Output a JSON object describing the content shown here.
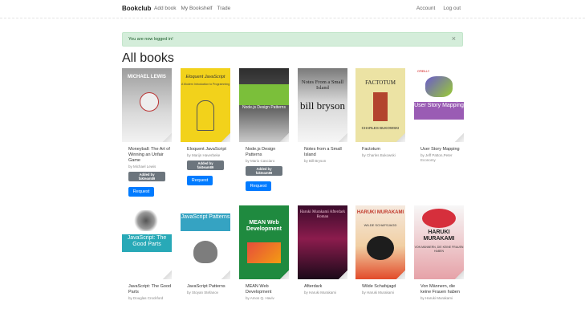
{
  "navbar": {
    "brand": "Bookclub",
    "left_links": [
      "Add book",
      "My Bookshelf",
      "Trade"
    ],
    "right_links": [
      "Account",
      "Log out"
    ]
  },
  "alert": {
    "message": "You are now logged in!",
    "close": "×"
  },
  "page": {
    "title": "All books"
  },
  "request_label": "Request",
  "added_label_line1": "Added by",
  "added_label_line2": "fakteam89",
  "books": [
    {
      "title": "Moneyball: The Art of Winning an Unfair Game",
      "author": "by Michael Lewis",
      "cover_top": "MICHAEL LEWIS",
      "cover_sub": "MONEYBALL"
    },
    {
      "title": "Eloquent JavaScript",
      "author": "by Marijn Haverbeke",
      "cover_top": "Eloquent JavaScript",
      "cover_sub": "A Modern Introduction to Programming"
    },
    {
      "title": "Node.js Design Patterns",
      "author": "by Mario Casciaro",
      "cover_top": "Node.js Design Patterns",
      "cover_sub": ""
    },
    {
      "title": "Notes from a Small Island",
      "author": "by Bill Bryson",
      "cover_top": "Notes From a Small Island",
      "cover_sub": "bill bryson"
    },
    {
      "title": "Factotum",
      "author": "by Charles Bukowski",
      "cover_top": "FACTOTUM",
      "cover_sub": "CHARLES BUKOWSKI"
    },
    {
      "title": "User Story Mapping",
      "author": "by Jeff Patton,Peter Economy",
      "cover_top": "O'REILLY",
      "cover_sub": "User Story Mapping"
    },
    {
      "title": "JavaScript: The Good Parts",
      "author": "by Douglas Crockford",
      "cover_top": "",
      "cover_sub": "JavaScript: The Good Parts"
    },
    {
      "title": "JavaScript Patterns",
      "author": "by Stoyan Stefanov",
      "cover_top": "",
      "cover_sub": "JavaScript Patterns"
    },
    {
      "title": "MEAN Web Development",
      "author": "by Amos Q. Haviv",
      "cover_top": "MEAN Web Development",
      "cover_sub": ""
    },
    {
      "title": "Afterdark",
      "author": "by Haruki Murakami",
      "cover_top": "Haruki Murakami Afterdark Roman",
      "cover_sub": ""
    },
    {
      "title": "Wilde Schafsjagd",
      "author": "by Haruki Murakami",
      "cover_top": "HARUKI MURAKAMI",
      "cover_sub": "WILDE SCHAFSJAGD"
    },
    {
      "title": "Von Männern, die keine Frauen haben",
      "author": "by Haruki Murakami",
      "cover_top": "HARUKI MURAKAMI",
      "cover_sub": "VON MÄNNERN, DIE KEINE FRAUEN HABEN"
    }
  ]
}
